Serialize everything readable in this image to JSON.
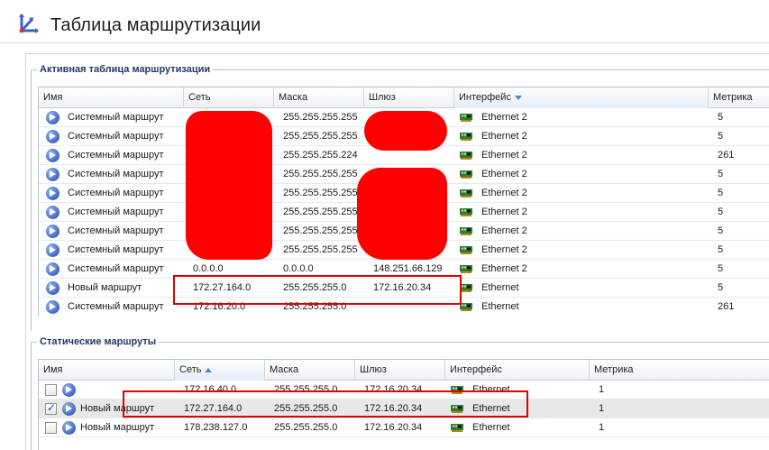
{
  "window": {
    "title": "Таблица маршрутизации",
    "icon": "routing-table-icon"
  },
  "active_table": {
    "group_title": "Активная таблица маршрутизации",
    "columns": [
      {
        "key": "name",
        "label": "Имя"
      },
      {
        "key": "network",
        "label": "Сеть"
      },
      {
        "key": "mask",
        "label": "Маска"
      },
      {
        "key": "gateway",
        "label": "Шлюз"
      },
      {
        "key": "interface",
        "label": "Интерфейс",
        "sort": "desc"
      },
      {
        "key": "metric",
        "label": "Метрика"
      }
    ],
    "rows": [
      {
        "name": "Системный маршрут",
        "network": "",
        "mask": "255.255.255.255",
        "gateway": "",
        "interface": "Ethernet 2",
        "metric": "5"
      },
      {
        "name": "Системный маршрут",
        "network": "",
        "mask": "255.255.255.255",
        "gateway": "",
        "interface": "Ethernet 2",
        "metric": "5"
      },
      {
        "name": "Системный маршрут",
        "network": "",
        "mask": "255.255.255.224",
        "gateway": "",
        "interface": "Ethernet 2",
        "metric": "261"
      },
      {
        "name": "Системный маршрут",
        "network": "",
        "mask": "255.255.255.255",
        "gateway": "",
        "interface": "Ethernet 2",
        "metric": "5"
      },
      {
        "name": "Системный маршрут",
        "network": "",
        "mask": "255.255.255.255",
        "gateway": "",
        "interface": "Ethernet 2",
        "metric": "5"
      },
      {
        "name": "Системный маршрут",
        "network": "",
        "mask": "255.255.255.255",
        "gateway": "",
        "interface": "Ethernet 2",
        "metric": "5"
      },
      {
        "name": "Системный маршрут",
        "network": "",
        "mask": "255.255.255.255",
        "gateway": "",
        "interface": "Ethernet 2",
        "metric": "5"
      },
      {
        "name": "Системный маршрут",
        "network": "",
        "mask": "255.255.255.255",
        "gateway": "",
        "interface": "Ethernet 2",
        "metric": "5"
      },
      {
        "name": "Системный маршрут",
        "network": "0.0.0.0",
        "mask": "0.0.0.0",
        "gateway": "148.251.66.129",
        "interface": "Ethernet 2",
        "metric": "5"
      },
      {
        "name": "Новый маршрут",
        "network": "172.27.164.0",
        "mask": "255.255.255.0",
        "gateway": "172.16.20.34",
        "interface": "Ethernet",
        "metric": "5"
      },
      {
        "name": "Системный маршрут",
        "network": "172.16.20.0",
        "mask": "255.255.255.0",
        "gateway": "",
        "interface": "Ethernet",
        "metric": "261"
      }
    ]
  },
  "static_routes": {
    "group_title": "Статические маршруты",
    "columns": [
      {
        "key": "name",
        "label": "Имя"
      },
      {
        "key": "network",
        "label": "Сеть",
        "sort": "asc"
      },
      {
        "key": "mask",
        "label": "Маска"
      },
      {
        "key": "gateway",
        "label": "Шлюз"
      },
      {
        "key": "interface",
        "label": "Интерфейс"
      },
      {
        "key": "metric",
        "label": "Метрика"
      }
    ],
    "rows": [
      {
        "checked": false,
        "name": "",
        "network": "172.16.40.0",
        "mask": "255.255.255.0",
        "gateway": "172.16.20.34",
        "interface": "Ethernet",
        "metric": "1"
      },
      {
        "checked": true,
        "name": "Новый маршрут",
        "network": "172.27.164.0",
        "mask": "255.255.255.0",
        "gateway": "172.16.20.34",
        "interface": "Ethernet",
        "metric": "1"
      },
      {
        "checked": false,
        "name": "Новый маршрут",
        "network": "178.238.127.0",
        "mask": "255.255.255.0",
        "gateway": "172.16.20.34",
        "interface": "Ethernet",
        "metric": "1"
      }
    ]
  },
  "colors": {
    "highlight": "#e00000",
    "redaction": "#ff0000",
    "group_title": "#223a63",
    "sort_arrow": "#4f86c9"
  }
}
